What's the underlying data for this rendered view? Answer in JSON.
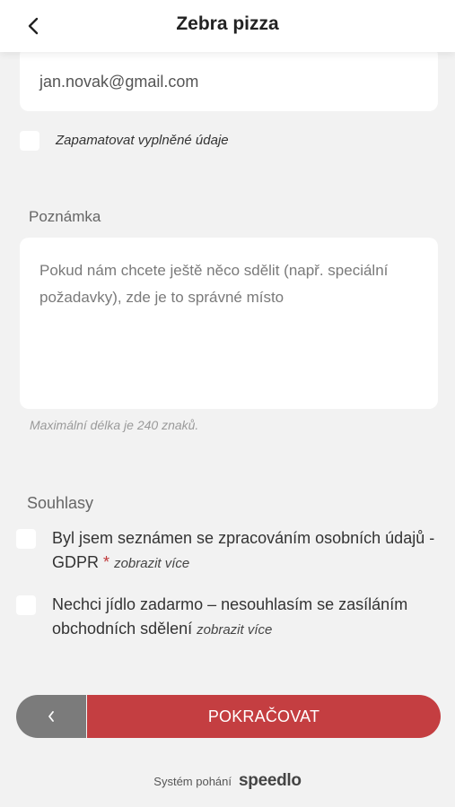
{
  "header": {
    "title": "Zebra pizza",
    "back_icon": "chevron-left-icon"
  },
  "form": {
    "email_value": "jan.novak@gmail.com",
    "remember_label": "Zapamatovat vyplněné údaje",
    "note_label": "Poznámka",
    "note_placeholder": "Pokud nám chcete ještě něco sdělit (např. speciální požadavky), zde je to správné místo",
    "note_hint": "Maximální délka je 240 znaků."
  },
  "consents": {
    "label": "Souhlasy",
    "gdpr_text": "Byl jsem seznámen se zpracováním osobních údajů - GDPR",
    "gdpr_required_mark": "*",
    "gdpr_more": "zobrazit více",
    "marketing_text": "Nechci jídlo zadarmo – nesouhlasím se zasíláním obchodních sdělení",
    "marketing_more": "zobrazit více"
  },
  "actions": {
    "continue_label": "POKRAČOVAT"
  },
  "footer": {
    "powered_by": "Systém pohání",
    "brand": "speedlo"
  },
  "colors": {
    "accent": "#c43e41",
    "secondary_button": "#7b7b7b",
    "background": "#f2f2f2"
  }
}
